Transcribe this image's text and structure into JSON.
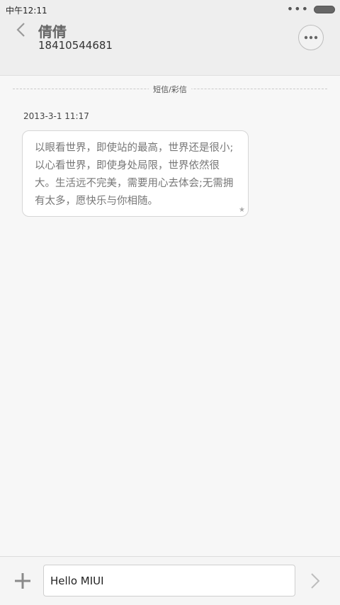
{
  "status_bar": {
    "time": "中午12:11",
    "dots": "•••"
  },
  "header": {
    "contact_name": "倩倩",
    "phone_number": "18410544681"
  },
  "conversation": {
    "divider_label": "短信/彩信",
    "messages": [
      {
        "timestamp": "2013-3-1 11:17",
        "text": "以眼看世界，即使站的最高，世界还是很小;以心看世界，即使身处局限，世界依然很大。生活远不完美，需要用心去体会;无需拥有太多，愿快乐与你相随。",
        "star": "★"
      }
    ]
  },
  "composer": {
    "input_value": "Hello MIUI"
  },
  "icons": {
    "back": "chevron-left-icon",
    "more": "more-icon",
    "add": "plus-icon",
    "send": "chevron-right-icon",
    "battery": "battery-icon",
    "star": "star-icon"
  },
  "colors": {
    "header_bg": "#eeeeee",
    "page_bg": "#f7f7f7",
    "bubble_bg": "#ffffff",
    "text_secondary": "#777777"
  }
}
